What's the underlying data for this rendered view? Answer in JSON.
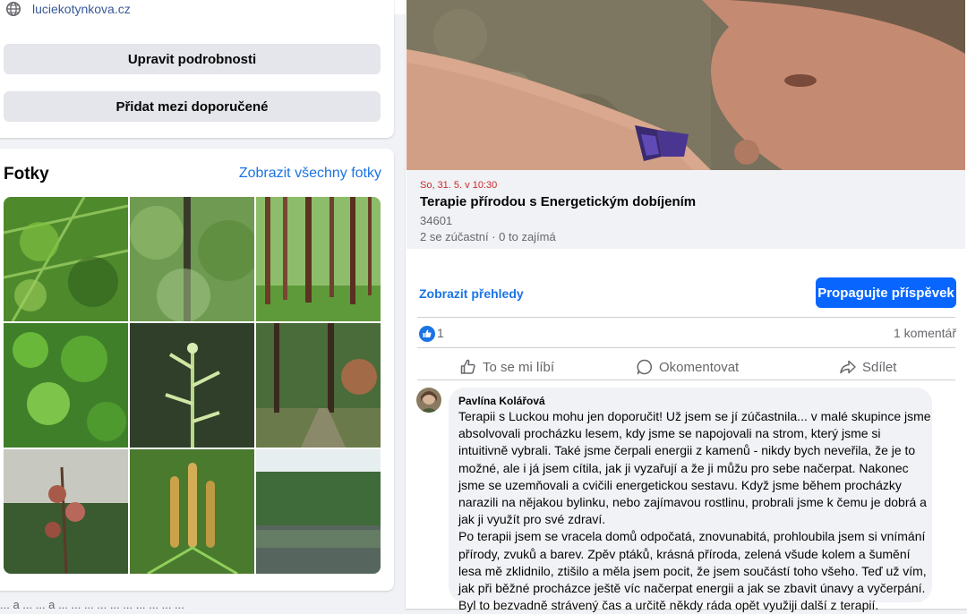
{
  "intro": {
    "website": "luciekotynkova.cz",
    "edit_details_label": "Upravit podrobnosti",
    "add_featured_label": "Přidat mezi doporučené"
  },
  "photos": {
    "title": "Fotky",
    "see_all_label": "Zobrazit všechny fotky"
  },
  "event": {
    "date": "So, 31. 5. v 10:30",
    "title": "Terapie přírodou s Energetickým dobíjením",
    "code": "34601",
    "stats": "2 se zúčastní · 0 to zajímá"
  },
  "post": {
    "insights_label": "Zobrazit přehledy",
    "promote_label": "Propagujte příspěvek",
    "like_count": "1",
    "comment_count": "1 komentář",
    "actions": {
      "like": "To se mi líbí",
      "comment": "Okomentovat",
      "share": "Sdílet"
    }
  },
  "comment": {
    "author": "Pavlína Kolářová",
    "paragraphs": [
      "Terapii s Luckou mohu jen doporučit! Už jsem se jí zúčastnila... v malé skupince jsme absolvovali procházku lesem, kdy jsme se napojovali na strom, který jsme si intuitivně vybrali. Také jsme čerpali energii z kamenů - nikdy bych neveřila, že je to možné, ale i já jsem cítila, jak ji vyzařují a že ji můžu pro sebe načerpat. Nakonec jsme se uzemňovali a cvičili energetickou sestavu. Když jsme během procházky narazili na nějakou bylinku, nebo zajímavou rostlinu, probrali jsme k čemu je dobrá a jak ji využít pro své zdraví.",
      "Po terapii jsem se vracela domů odpočatá, znovunabitá, prohloubila jsem si vnímání přírody, zvuků a barev. Zpěv ptáků, krásná příroda, zelená všude kolem a šumění lesa mě zklidnilo, ztišilo a měla jsem pocit, že jsem součástí toho všeho. Teď už vím, jak při běžné procházce ještě víc načerpat energii a jak se zbavit únavy a vyčerpání.",
      "Byl to bezvadně strávený čas a určitě někdy ráda opět využiji další z terapií."
    ]
  },
  "footer": {
    "cut_text": "... a ... ... a ... ... ... ... ... ... ... ... ... ..."
  }
}
